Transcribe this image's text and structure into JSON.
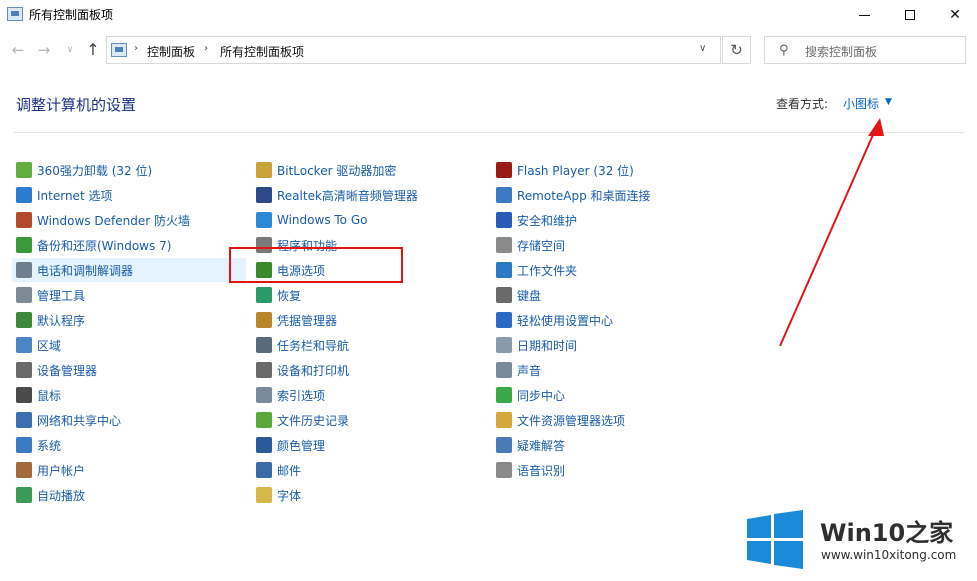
{
  "window": {
    "title": "所有控制面板项",
    "minimize_icon": "minimize-icon",
    "maximize_icon": "maximize-icon",
    "close_glyph": "✕"
  },
  "navbar": {
    "back_glyph": "←",
    "forward_glyph": "→",
    "recent_glyph": "∨",
    "up_glyph": "↑",
    "breadcrumb": [
      "控制面板",
      "所有控制面板项"
    ],
    "crumb_sep": "›",
    "dropdown_glyph": "∨",
    "refresh_glyph": "↻",
    "search_placeholder": "搜索控制面板",
    "search_glyph": "⚲"
  },
  "header": {
    "title": "调整计算机的设置",
    "view_label": "查看方式:",
    "view_value": "小图标",
    "view_caret": "▼"
  },
  "columns": [
    {
      "items": [
        {
          "label": "360强力卸载 (32 位)",
          "icon": "uninstall-icon",
          "color": "#5fae3e"
        },
        {
          "label": "Internet 选项",
          "icon": "internet-options-icon",
          "color": "#2b7bd0"
        },
        {
          "label": "Windows Defender 防火墙",
          "icon": "firewall-icon",
          "color": "#b34a2a"
        },
        {
          "label": "备份和还原(Windows 7)",
          "icon": "backup-icon",
          "color": "#3a9a3a"
        },
        {
          "label": "电话和调制解调器",
          "icon": "phone-modem-icon",
          "color": "#6f7f8f",
          "selected": true
        },
        {
          "label": "管理工具",
          "icon": "admin-tools-icon",
          "color": "#7d8a96"
        },
        {
          "label": "默认程序",
          "icon": "default-programs-icon",
          "color": "#3a8a3a"
        },
        {
          "label": "区域",
          "icon": "region-icon",
          "color": "#4a86c5"
        },
        {
          "label": "设备管理器",
          "icon": "device-manager-icon",
          "color": "#6a6a6a"
        },
        {
          "label": "鼠标",
          "icon": "mouse-icon",
          "color": "#4a4a4a"
        },
        {
          "label": "网络和共享中心",
          "icon": "network-icon",
          "color": "#3d6fb5"
        },
        {
          "label": "系统",
          "icon": "system-icon",
          "color": "#3a7cc4"
        },
        {
          "label": "用户帐户",
          "icon": "user-accounts-icon",
          "color": "#a56a3a"
        },
        {
          "label": "自动播放",
          "icon": "autoplay-icon",
          "color": "#3a9a5a"
        }
      ]
    },
    {
      "items": [
        {
          "label": "BitLocker 驱动器加密",
          "icon": "bitlocker-icon",
          "color": "#c7a33a"
        },
        {
          "label": "Realtek高清晰音频管理器",
          "icon": "realtek-audio-icon",
          "color": "#2c4a8a"
        },
        {
          "label": "Windows To Go",
          "icon": "windows-to-go-icon",
          "color": "#2b8ad8"
        },
        {
          "label": "程序和功能",
          "icon": "programs-features-icon",
          "color": "#7a7a7a"
        },
        {
          "label": "电源选项",
          "icon": "power-options-icon",
          "color": "#3a8a2a"
        },
        {
          "label": "恢复",
          "icon": "recovery-icon",
          "color": "#2a9a6a"
        },
        {
          "label": "凭据管理器",
          "icon": "credential-manager-icon",
          "color": "#b8862a"
        },
        {
          "label": "任务栏和导航",
          "icon": "taskbar-icon",
          "color": "#5a6a7a"
        },
        {
          "label": "设备和打印机",
          "icon": "devices-printers-icon",
          "color": "#6a6a6a"
        },
        {
          "label": "索引选项",
          "icon": "indexing-icon",
          "color": "#7a8a9a"
        },
        {
          "label": "文件历史记录",
          "icon": "file-history-icon",
          "color": "#5aa83a"
        },
        {
          "label": "颜色管理",
          "icon": "color-management-icon",
          "color": "#2a5a9a"
        },
        {
          "label": "邮件",
          "icon": "mail-icon",
          "color": "#3a6aa8"
        },
        {
          "label": "字体",
          "icon": "fonts-icon",
          "color": "#d4b84a"
        }
      ]
    },
    {
      "items": [
        {
          "label": "Flash Player (32 位)",
          "icon": "flash-player-icon",
          "color": "#9a1a1a"
        },
        {
          "label": "RemoteApp 和桌面连接",
          "icon": "remoteapp-icon",
          "color": "#3a7ac4"
        },
        {
          "label": "安全和维护",
          "icon": "security-maintenance-icon",
          "color": "#2a5ab8"
        },
        {
          "label": "存储空间",
          "icon": "storage-spaces-icon",
          "color": "#8a8a8a"
        },
        {
          "label": "工作文件夹",
          "icon": "work-folders-icon",
          "color": "#2a7ac4"
        },
        {
          "label": "键盘",
          "icon": "keyboard-icon",
          "color": "#6a6a6a"
        },
        {
          "label": "轻松使用设置中心",
          "icon": "ease-of-access-icon",
          "color": "#2a6ac4"
        },
        {
          "label": "日期和时间",
          "icon": "date-time-icon",
          "color": "#8a9aaa"
        },
        {
          "label": "声音",
          "icon": "sound-icon",
          "color": "#7a8a9a"
        },
        {
          "label": "同步中心",
          "icon": "sync-center-icon",
          "color": "#3aa84a"
        },
        {
          "label": "文件资源管理器选项",
          "icon": "explorer-options-icon",
          "color": "#d4a83a"
        },
        {
          "label": "疑难解答",
          "icon": "troubleshooting-icon",
          "color": "#4a7ab8"
        },
        {
          "label": "语音识别",
          "icon": "speech-recognition-icon",
          "color": "#8a8a8a"
        }
      ]
    }
  ],
  "annotation": {
    "box_color": "#e21616",
    "arrow_color": "#e21616"
  },
  "watermark": {
    "title_prefix": "Win10",
    "title_suffix": "之家",
    "url": "www.win10xitong.com",
    "accent": "#1b8ad8"
  }
}
